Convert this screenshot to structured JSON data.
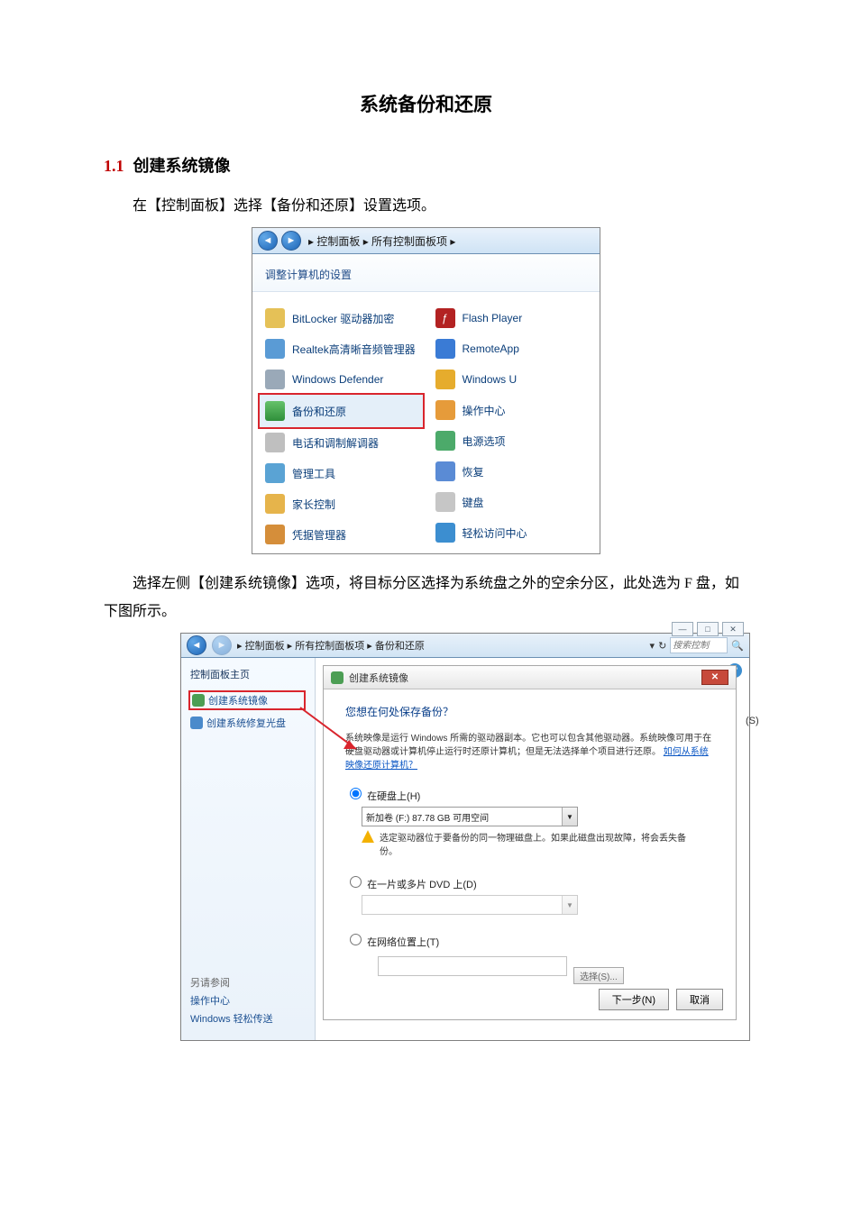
{
  "doc": {
    "title": "系统备份和还原",
    "section_num": "1.1",
    "section_title": "创建系统镜像",
    "para1": "在【控制面板】选择【备份和还原】设置选项。",
    "para2": "选择左侧【创建系统镜像】选项，将目标分区选择为系统盘之外的空余分区，此处选为 F 盘，如下图所示。"
  },
  "cp": {
    "breadcrumb": "▸ 控制面板 ▸ 所有控制面板项 ▸",
    "header": "调整计算机的设置",
    "left": [
      {
        "label": "BitLocker 驱动器加密",
        "icon": "bitlocker"
      },
      {
        "label": "Realtek高清晰音频管理器",
        "icon": "realtek"
      },
      {
        "label": "Windows Defender",
        "icon": "defender"
      },
      {
        "label": "备份和还原",
        "icon": "backup",
        "hl": true
      },
      {
        "label": "电话和调制解调器",
        "icon": "phone"
      },
      {
        "label": "管理工具",
        "icon": "admin"
      },
      {
        "label": "家长控制",
        "icon": "parent"
      },
      {
        "label": "凭据管理器",
        "icon": "cred"
      }
    ],
    "right": [
      {
        "label": "Flash Player",
        "icon": "flash"
      },
      {
        "label": "RemoteApp",
        "icon": "remote"
      },
      {
        "label": "Windows U",
        "icon": "update"
      },
      {
        "label": "操作中心",
        "icon": "action"
      },
      {
        "label": "电源选项",
        "icon": "power"
      },
      {
        "label": "恢复",
        "icon": "recovery"
      },
      {
        "label": "键盘",
        "icon": "keyboard"
      },
      {
        "label": "轻松访问中心",
        "icon": "ease"
      }
    ]
  },
  "bw": {
    "breadcrumb": "▸ 控制面板 ▸ 所有控制面板项 ▸ 备份和还原",
    "search_placeholder": "搜索控制",
    "side_title": "控制面板主页",
    "side_link1": "创建系统镜像",
    "side_link2": "创建系统修复光盘",
    "side_also": "另请参阅",
    "side_action": "操作中心",
    "side_easy": "Windows 轻松传送",
    "right_paren": "(S)",
    "wizard": {
      "title": "创建系统镜像",
      "question": "您想在何处保存备份？",
      "desc": "系统映像是运行 Windows 所需的驱动器副本。它也可以包含其他驱动器。系统映像可用于在硬盘驱动器或计算机停止运行时还原计算机；但是无法选择单个项目进行还原。",
      "desc_link": "如何从系统映像还原计算机？",
      "opt1": "在硬盘上(H)",
      "combo1": "新加卷 (F:)  87.78 GB 可用空间",
      "warn": "选定驱动器位于要备份的同一物理磁盘上。如果此磁盘出现故障，将会丢失备份。",
      "opt2": "在一片或多片 DVD 上(D)",
      "opt3": "在网络位置上(T)",
      "browse": "选择(S)...",
      "next": "下一步(N)",
      "cancel": "取消"
    }
  }
}
